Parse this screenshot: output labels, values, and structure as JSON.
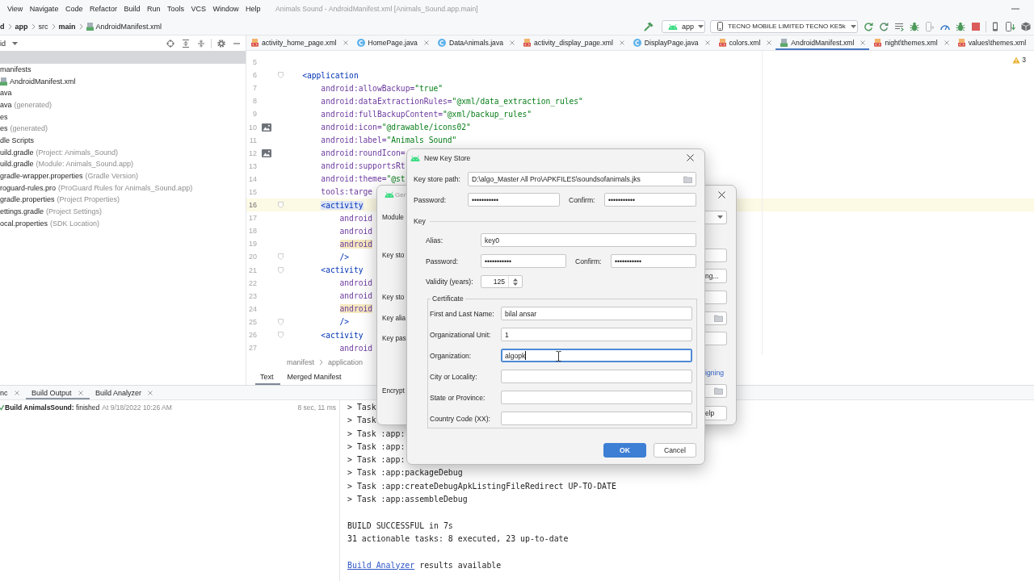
{
  "menu_bar": {
    "items": [
      "View",
      "Navigate",
      "Code",
      "Refactor",
      "Build",
      "Run",
      "Tools",
      "VCS",
      "Window",
      "Help"
    ],
    "title": "Animals Sound - AndroidManifest.xml [Animals_Sound.app.main]"
  },
  "navigation_bar": {
    "breadcrumb": [
      {
        "label": "d",
        "bold": true
      },
      {
        "label": "app",
        "bold": true
      },
      {
        "label": "src",
        "bold": false
      },
      {
        "label": "main",
        "bold": true
      },
      {
        "label": "AndroidManifest.xml",
        "kind": "manifest",
        "bold": false
      }
    ],
    "run_configuration": "app",
    "device": "TECNO MOBILE LIMITED TECNO KE5k"
  },
  "project_panel": {
    "view": "id",
    "tree": [
      {
        "label": "manifests",
        "children": [
          {
            "label": "AndroidManifest.xml",
            "kind": "manifest"
          }
        ]
      },
      {
        "label": "ava"
      },
      {
        "label": "ava",
        "hint": "(generated)"
      },
      {
        "label": "es"
      },
      {
        "label": "es",
        "hint": "(generated)"
      },
      {
        "label": "dle Scripts",
        "children": [
          {
            "label": "uild.gradle",
            "hint": "(Project: Animals_Sound)"
          },
          {
            "label": "uild.gradle",
            "hint": "(Module: Animals_Sound.app)"
          },
          {
            "label": "gradle-wrapper.properties",
            "hint": "(Gradle Version)"
          },
          {
            "label": "roguard-rules.pro",
            "hint": "(ProGuard Rules for Animals_Sound.app)"
          },
          {
            "label": "gradle.properties",
            "hint": "(Project Properties)"
          },
          {
            "label": "ettings.gradle",
            "hint": "(Project Settings)"
          },
          {
            "label": "ocal.properties",
            "hint": "(SDK Location)"
          }
        ]
      }
    ]
  },
  "editor": {
    "tabs": [
      {
        "label": "activity_home_page.xml",
        "kind": "xml",
        "selected": false,
        "closable": true
      },
      {
        "label": "HomePage.java",
        "kind": "java",
        "selected": false,
        "closable": true
      },
      {
        "label": "DataAnimals.java",
        "kind": "java",
        "selected": false,
        "closable": true
      },
      {
        "label": "activity_display_page.xml",
        "kind": "xml",
        "selected": false,
        "closable": true
      },
      {
        "label": "DisplayPage.java",
        "kind": "java",
        "selected": false,
        "closable": true
      },
      {
        "label": "colors.xml",
        "kind": "xml",
        "selected": false,
        "closable": true
      },
      {
        "label": "AndroidManifest.xml",
        "kind": "manifest",
        "selected": true,
        "closable": true
      },
      {
        "label": "night\\themes.xml",
        "kind": "xml",
        "selected": false,
        "closable": true
      },
      {
        "label": "values\\themes.xml",
        "kind": "xml",
        "selected": false,
        "closable": false
      }
    ],
    "warnings": "3",
    "lines": [
      {
        "number": "5",
        "kind": "plain",
        "current": false
      },
      {
        "number": "6",
        "kind": "fold",
        "current": false,
        "tokens": [
          {
            "kind": "tag",
            "text": "<application"
          }
        ],
        "children": [
          {
            "number": "7",
            "kind": "plain",
            "current": false,
            "tokens": [
              {
                "kind": "attr",
                "text": "android:allowBackup="
              },
              {
                "kind": "value",
                "text": "\"true\""
              }
            ]
          },
          {
            "number": "8",
            "kind": "plain",
            "current": false,
            "tokens": [
              {
                "kind": "attr",
                "text": "android:dataExtractionRules="
              },
              {
                "kind": "value",
                "text": "\"@xml/data_extraction_rules\""
              }
            ]
          },
          {
            "number": "9",
            "kind": "plain",
            "current": false,
            "tokens": [
              {
                "kind": "attr",
                "text": "android:fullBackupContent="
              },
              {
                "kind": "value",
                "text": "\"@xml/backup_rules\""
              }
            ]
          },
          {
            "number": "10",
            "kind": "image",
            "current": false,
            "tokens": [
              {
                "kind": "attr",
                "text": "android:icon="
              },
              {
                "kind": "value",
                "text": "\"@drawable/icons02\""
              }
            ]
          },
          {
            "number": "11",
            "kind": "plain",
            "current": false,
            "tokens": [
              {
                "kind": "attr",
                "text": "android:label="
              },
              {
                "kind": "value",
                "text": "\"Animals Sound\""
              }
            ]
          },
          {
            "number": "12",
            "kind": "image",
            "current": false,
            "tokens": [
              {
                "kind": "attr",
                "text": "android:roundIcon="
              }
            ]
          },
          {
            "number": "13",
            "kind": "plain",
            "current": false,
            "tokens": [
              {
                "kind": "attr",
                "text": "android:supportsRt"
              }
            ]
          },
          {
            "number": "14",
            "kind": "plain",
            "current": false,
            "tokens": [
              {
                "kind": "attr",
                "text": "android:theme="
              },
              {
                "kind": "value",
                "text": "\"@st"
              }
            ]
          },
          {
            "number": "15",
            "kind": "plain",
            "current": false,
            "tokens": [
              {
                "kind": "attr",
                "text": "tools:targe"
              }
            ]
          },
          {
            "number": "16",
            "kind": "fold",
            "current": true,
            "tokens": [
              {
                "kind": "matched",
                "text": "<activity"
              }
            ],
            "children": [
              {
                "number": "17",
                "kind": "plain",
                "current": false,
                "tokens": [
                  {
                    "kind": "attr",
                    "text": "android"
                  }
                ]
              },
              {
                "number": "18",
                "kind": "plain",
                "current": false,
                "tokens": [
                  {
                    "kind": "attr",
                    "text": "android"
                  }
                ]
              },
              {
                "number": "19",
                "kind": "plain",
                "current": false,
                "tokens": [
                  {
                    "kind": "warning",
                    "text": "android"
                  }
                ]
              },
              {
                "number": "20",
                "kind": "fold",
                "current": false,
                "tokens": [
                  {
                    "kind": "tag",
                    "text": "/>"
                  }
                ]
              }
            ]
          },
          {
            "number": "21",
            "kind": "fold",
            "current": false,
            "tokens": [
              {
                "kind": "tag",
                "text": "<activity"
              }
            ],
            "children": [
              {
                "number": "22",
                "kind": "plain",
                "current": false,
                "tokens": [
                  {
                    "kind": "attr",
                    "text": "android"
                  }
                ]
              },
              {
                "number": "23",
                "kind": "plain",
                "current": false,
                "tokens": [
                  {
                    "kind": "attr",
                    "text": "android"
                  }
                ]
              },
              {
                "number": "24",
                "kind": "plain",
                "current": false,
                "tokens": [
                  {
                    "kind": "warning",
                    "text": "android"
                  }
                ]
              },
              {
                "number": "25",
                "kind": "fold",
                "current": false,
                "tokens": [
                  {
                    "kind": "tag",
                    "text": "/>"
                  }
                ]
              }
            ]
          },
          {
            "number": "26",
            "kind": "fold",
            "current": false,
            "tokens": [
              {
                "kind": "tag",
                "text": "<activity"
              }
            ],
            "children": [
              {
                "number": "27",
                "kind": "plain",
                "current": false,
                "tokens": [
                  {
                    "kind": "attr",
                    "text": "android"
                  }
                ]
              }
            ]
          }
        ]
      }
    ],
    "breadcrumb": [
      "manifest",
      "application"
    ],
    "view_tabs": [
      {
        "label": "Text",
        "selected": true
      },
      {
        "label": "Merged Manifest",
        "selected": false
      }
    ]
  },
  "build_panel": {
    "tabs": [
      {
        "label": "nc",
        "selected": false
      },
      {
        "label": "Build Output",
        "selected": true
      },
      {
        "label": "Build Analyzer",
        "selected": false
      }
    ],
    "status": {
      "succeeded": true,
      "text": "**Build AnimalsSound:** finished",
      "time": "At 9/18/2022 10:26 AM",
      "duration": "8 sec, 11 ms"
    },
    "console": {
      "tasks": [
        "> Task",
        "> Task",
        "> Task :app:",
        "> Task :app:",
        "> Task :app:",
        "> Task :app:packageDebug",
        "> Task :app:createDebugApkListingFileRedirect UP-TO-DATE",
        "> Task :app:assembleDebug"
      ],
      "summary": [
        "BUILD SUCCESSFUL in 7s",
        "31 actionable tasks: 8 executed, 23 up-to-date"
      ],
      "analyzer": {
        "link": "Build Analyzer",
        "text": "results available"
      }
    }
  },
  "signing_dialog": {
    "title": "Gen",
    "rows": [
      {
        "label": "Module",
        "kind": "dropdown"
      },
      {
        "label": "Key sto",
        "kind": "field"
      },
      {
        "kind": "button",
        "text": "ng..."
      },
      {
        "label": "Key sto",
        "kind": "field"
      },
      {
        "label": "Key alia",
        "kind": "folder_field"
      },
      {
        "label": "Key pas",
        "kind": "field"
      },
      {
        "kind": "link",
        "text": "igning"
      },
      {
        "label": "Encrypt",
        "kind": "folder_field"
      },
      {
        "kind": "button",
        "text": "elp"
      }
    ]
  },
  "key_store_dialog": {
    "title": "New Key Store",
    "path": {
      "label": "Key store path:",
      "value": "D:\\algo_Master All Pro\\APKFILES\\soundsofanimals.jks"
    },
    "password": {
      "label": "Password:",
      "value": "•••••••••••"
    },
    "confirm": {
      "label": "Confirm:",
      "value": "•••••••••••"
    },
    "key": {
      "heading": "Key",
      "alias": {
        "label": "Alias:",
        "value": "key0"
      },
      "password": {
        "label": "Password:",
        "value": "•••••••••••"
      },
      "confirm": {
        "label": "Confirm:",
        "value": "•••••••••••"
      },
      "validity": {
        "label": "Validity (years):",
        "value": "125"
      },
      "certificate": {
        "heading": "Certificate",
        "fields": [
          {
            "label": "First and Last Name:",
            "value": "bilal ansar",
            "focused": false
          },
          {
            "label": "Organizational Unit:",
            "value": "1",
            "focused": false
          },
          {
            "label": "Organization:",
            "value": "algopk",
            "focused": true
          },
          {
            "label": "City or Locality:",
            "focused": false
          },
          {
            "label": "State or Province:",
            "focused": false
          },
          {
            "label": "Country Code (XX):",
            "focused": false
          }
        ]
      }
    },
    "buttons": [
      {
        "label": "OK",
        "primary": true
      },
      {
        "label": "Cancel",
        "primary": false
      }
    ]
  }
}
